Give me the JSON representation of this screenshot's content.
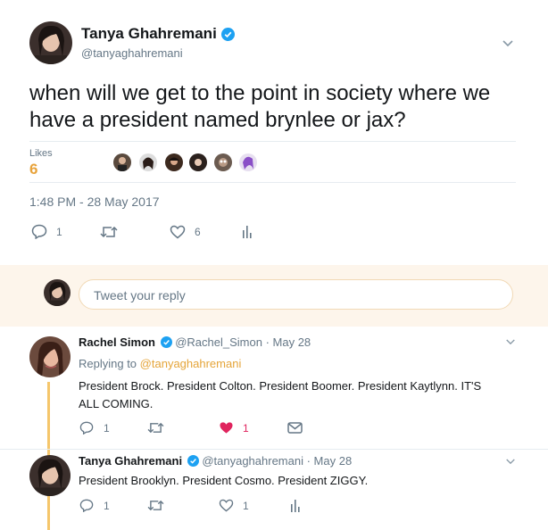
{
  "main_tweet": {
    "author_name": "Tanya Ghahremani",
    "author_handle": "@tanyaghahremani",
    "text": "when will we get to the point in society where we have a president named brynlee or jax?",
    "likes_label": "Likes",
    "likes_count": "6",
    "timestamp": "1:48 PM - 28 May 2017",
    "reply_count": "1",
    "like_count": "6"
  },
  "reply_box": {
    "placeholder": "Tweet your reply"
  },
  "replies": [
    {
      "author_name": "Rachel Simon",
      "author_handle": "@Rachel_Simon",
      "date": "· May 28",
      "replying_to_prefix": "Replying to",
      "replying_to_handle": "@tanyaghahremani",
      "text": "President Brock. President Colton. President Boomer. President Kaytlynn. IT'S ALL COMING.",
      "reply_count": "1",
      "like_count": "1"
    },
    {
      "author_name": "Tanya Ghahremani",
      "author_handle": "@tanyaghahremani",
      "date": "· May 28",
      "text": "President Brooklyn. President Cosmo. President ZIGGY.",
      "reply_count": "1",
      "like_count": "1"
    }
  ],
  "colors": {
    "accent_gold": "#e8a33b",
    "link_gold": "#e5a53a",
    "verified_blue": "#1da1f2",
    "heart_red": "#e0245e",
    "reply_bg": "#fdf5eb",
    "thread_line": "#f5c66b"
  }
}
